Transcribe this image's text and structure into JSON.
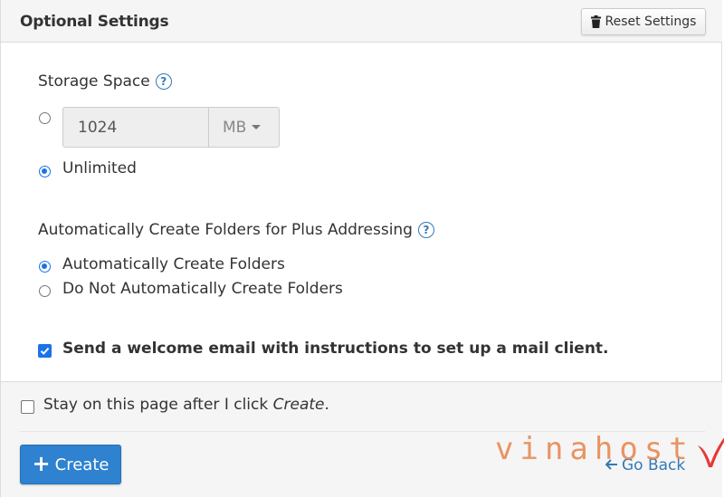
{
  "header": {
    "title": "Optional Settings",
    "reset_label": "Reset Settings"
  },
  "storage": {
    "label": "Storage Space",
    "input_value": "1024",
    "unit": "MB",
    "custom_selected": false,
    "unlimited_label": "Unlimited",
    "unlimited_selected": true
  },
  "plus_addressing": {
    "label": "Automatically Create Folders for Plus Addressing",
    "options": [
      {
        "label": "Automatically Create Folders",
        "selected": true
      },
      {
        "label": "Do Not Automatically Create Folders",
        "selected": false
      }
    ]
  },
  "welcome": {
    "label": "Send a welcome email with instructions to set up a mail client.",
    "checked": true
  },
  "footer": {
    "stay_text": "Stay on this page after I click ",
    "stay_emphasis": "Create",
    "stay_end": ".",
    "stay_checked": false,
    "create_label": "Create",
    "go_back_label": "Go Back"
  },
  "watermark": {
    "text": "vinahost"
  },
  "colors": {
    "accent": "#2e82cf",
    "link": "#337ab7",
    "radio_checked": "#1a73e8",
    "watermark": "#e6844a",
    "watermark_check": "#e53935"
  }
}
